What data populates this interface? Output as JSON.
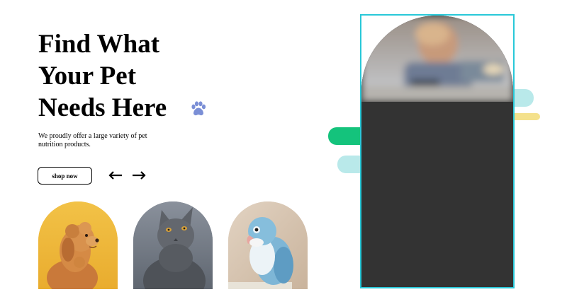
{
  "hero": {
    "headline_line1": "Find What",
    "headline_line2": "Your Pet",
    "headline_line3": "Needs Here",
    "tagline": "We proudly offer a large variety of pet nutrition products.",
    "shop_button_label": "shop now",
    "paw_icon_color": "#7b8fd6"
  },
  "pets": [
    {
      "name": "dog",
      "bg_color": "#f0b93a"
    },
    {
      "name": "cat",
      "bg_color": "#6f7684"
    },
    {
      "name": "parrot",
      "bg_color": "#d8c7b5"
    }
  ],
  "decor_colors": {
    "frame_border": "#29c8d8",
    "green_pill": "#14c37c",
    "teal_pill": "#b9e9ea",
    "yellow_pill": "#f4e18c",
    "hero_bg": "#333333"
  }
}
